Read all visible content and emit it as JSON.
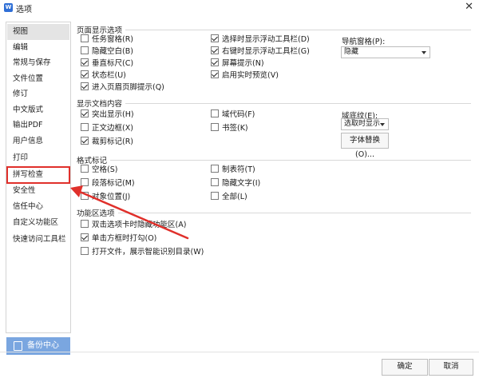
{
  "window": {
    "title": "选项",
    "app_icon_text": "W"
  },
  "nav": {
    "items": [
      "视图",
      "编辑",
      "常规与保存",
      "文件位置",
      "修订",
      "中文版式",
      "输出PDF",
      "用户信息",
      "打印",
      "拼写检查",
      "安全性",
      "信任中心",
      "自定义功能区",
      "快速访问工具栏"
    ],
    "active": "视图",
    "highlighted": "拼写检查"
  },
  "backup_button": "备份中心",
  "sections": {
    "page_display": {
      "title": "页面显示选项",
      "col1": [
        {
          "label": "任务窗格(R)",
          "checked": false
        },
        {
          "label": "隐藏空白(B)",
          "checked": false
        },
        {
          "label": "垂直标尺(C)",
          "checked": true
        },
        {
          "label": "状态栏(U)",
          "checked": true
        },
        {
          "label": "进入页眉页脚提示(Q)",
          "checked": true
        }
      ],
      "col2": [
        {
          "label": "选择时显示浮动工具栏(D)",
          "checked": true
        },
        {
          "label": "右键时显示浮动工具栏(G)",
          "checked": true
        },
        {
          "label": "屏幕提示(N)",
          "checked": true
        },
        {
          "label": "启用实时预览(V)",
          "checked": true
        }
      ],
      "nav_pane_label": "导航窗格(P):",
      "nav_pane_value": "隐藏"
    },
    "doc_content": {
      "title": "显示文档内容",
      "col1": [
        {
          "label": "突出显示(H)",
          "checked": true
        },
        {
          "label": "正文边框(X)",
          "checked": false
        },
        {
          "label": "裁剪标记(R)",
          "checked": true
        }
      ],
      "col2": [
        {
          "label": "域代码(F)",
          "checked": false
        },
        {
          "label": "书签(K)",
          "checked": false
        }
      ],
      "field_shading_label": "域底纹(E):",
      "field_shading_value": "选取时显示",
      "font_sub_button": "字体替换(O)..."
    },
    "format_marks": {
      "title": "格式标记",
      "col1": [
        {
          "label": "空格(S)",
          "checked": false
        },
        {
          "label": "段落标记(M)",
          "checked": false
        },
        {
          "label": "对象位置(J)",
          "checked": false
        }
      ],
      "col2": [
        {
          "label": "制表符(T)",
          "checked": false
        },
        {
          "label": "隐藏文字(I)",
          "checked": false
        },
        {
          "label": "全部(L)",
          "checked": false
        }
      ]
    },
    "ribbon": {
      "title": "功能区选项",
      "items": [
        {
          "label": "双击选项卡时隐藏功能区(A)",
          "checked": false
        },
        {
          "label": "单击方框时打勾(O)",
          "checked": true
        },
        {
          "label": "打开文件，展示智能识别目录(W)",
          "checked": false
        }
      ]
    }
  },
  "footer": {
    "ok": "确定",
    "cancel": "取消"
  },
  "colors": {
    "highlight": "#e0302b",
    "backup": "#7aa6e0",
    "annotation_arrow": "#e0302b"
  }
}
